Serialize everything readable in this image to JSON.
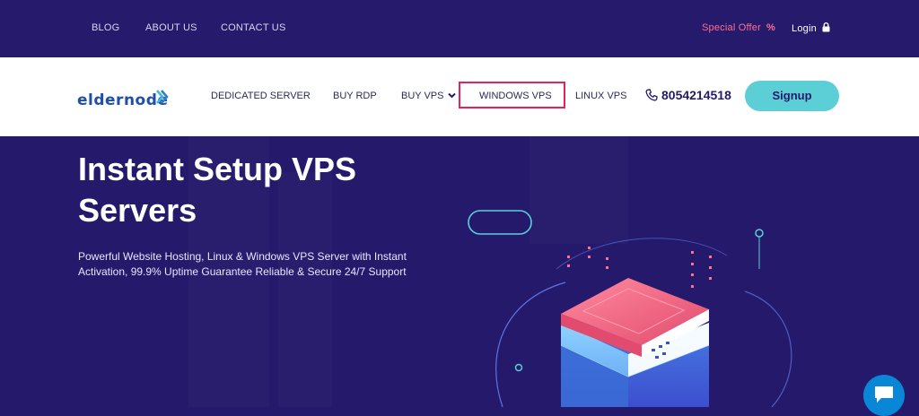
{
  "topbar": {
    "links": [
      "BLOG",
      "ABOUT US",
      "CONTACT US"
    ],
    "special_offer": "Special Offer",
    "special_offer_icon": "%",
    "login": "Login"
  },
  "navbar": {
    "logo_text": "eldernode",
    "items": [
      "DEDICATED SERVER",
      "BUY RDP",
      "BUY VPS",
      "WINDOWS VPS",
      "LINUX VPS"
    ],
    "phone": "8054214518",
    "signup": "Signup"
  },
  "hero": {
    "title_line1": "Instant Setup VPS",
    "title_line2": "Servers",
    "subtitle_line1": "Powerful Website Hosting, Linux & Windows VPS Server with Instant",
    "subtitle_line2": "Activation, 99.9% Uptime Guarantee Reliable & Secure 24/7 Support"
  },
  "colors": {
    "topbar_bg": "#251a6b",
    "hero_bg": "#24196a",
    "signup_bg": "#5ccfd6",
    "highlight": "#e3245b",
    "special_offer": "#ff6f8f",
    "chat": "#0a86d6"
  }
}
